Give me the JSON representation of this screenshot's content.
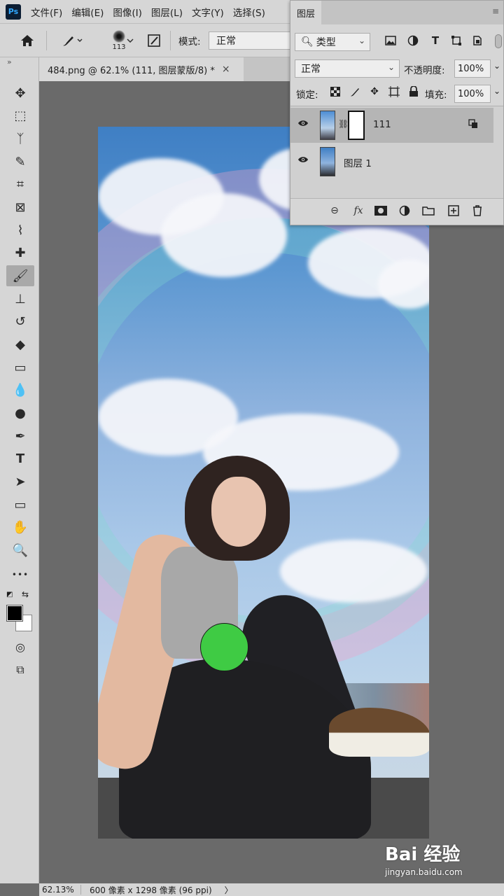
{
  "menu": {
    "logo": "Ps",
    "items": [
      "文件(F)",
      "编辑(E)",
      "图像(I)",
      "图层(L)",
      "文字(Y)",
      "选择(S)"
    ]
  },
  "options": {
    "home_icon": "home-icon",
    "brush_icon": "brush-icon",
    "brush_size": "113",
    "mode_label": "模式:",
    "mode_value": "正常"
  },
  "document": {
    "tab_title": "484.png @ 62.1% (111, 图层蒙版/8) *",
    "close_glyph": "×"
  },
  "toolbar": {
    "collapse": "»",
    "tools": [
      {
        "name": "move-tool",
        "glyph": "✥"
      },
      {
        "name": "marquee-tool",
        "glyph": "⬚"
      },
      {
        "name": "lasso-tool",
        "glyph": "ᛉ"
      },
      {
        "name": "quick-select-tool",
        "glyph": "✎"
      },
      {
        "name": "crop-tool",
        "glyph": "⌗"
      },
      {
        "name": "frame-tool",
        "glyph": "⊠"
      },
      {
        "name": "eyedropper-tool",
        "glyph": "⌇"
      },
      {
        "name": "healing-tool",
        "glyph": "✚"
      },
      {
        "name": "brush-tool",
        "glyph": "🖌",
        "active": true
      },
      {
        "name": "stamp-tool",
        "glyph": "⊥"
      },
      {
        "name": "history-brush-tool",
        "glyph": "↺"
      },
      {
        "name": "eraser-tool",
        "glyph": "◆"
      },
      {
        "name": "gradient-tool",
        "glyph": "▭"
      },
      {
        "name": "blur-tool",
        "glyph": "💧"
      },
      {
        "name": "dodge-tool",
        "glyph": "●"
      },
      {
        "name": "pen-tool",
        "glyph": "✒"
      },
      {
        "name": "type-tool",
        "glyph": "T"
      },
      {
        "name": "path-select-tool",
        "glyph": "➤"
      },
      {
        "name": "rectangle-tool",
        "glyph": "▭"
      },
      {
        "name": "hand-tool",
        "glyph": "✋"
      },
      {
        "name": "zoom-tool",
        "glyph": "🔍"
      },
      {
        "name": "more-tools",
        "glyph": "•••"
      }
    ],
    "default_colors": "◩",
    "swap_colors": "⇆",
    "quick_mask": "◎",
    "screen_mode": "⧉"
  },
  "layers": {
    "tab": "图层",
    "menu": "≡",
    "filter_kind": "类型",
    "filter_icons": [
      "image-filter-icon",
      "adjustment-filter-icon",
      "type-filter-icon",
      "shape-filter-icon",
      "smart-object-filter-icon"
    ],
    "blend_mode": "正常",
    "opacity_label": "不透明度:",
    "opacity": "100%",
    "lock_label": "锁定:",
    "fill_label": "填充:",
    "fill": "100%",
    "items": [
      {
        "name": "111",
        "selected": true
      },
      {
        "name": "图层 1",
        "selected": false
      }
    ],
    "footer_icons": [
      "link-icon",
      "fx-icon",
      "mask-icon",
      "adjustment-icon",
      "folder-icon",
      "new-layer-icon",
      "trash-icon"
    ]
  },
  "status": {
    "zoom": "62.13%",
    "doc_size": "600 像素 x 1298 像素 (96 ppi)",
    "arrow": "〉"
  },
  "watermark": {
    "title": "Bai 经验",
    "url": "jingyan.baidu.com"
  },
  "colors": {
    "foreground": "#000000",
    "background": "#ffffff",
    "brush_cursor": "#3fcb44"
  }
}
